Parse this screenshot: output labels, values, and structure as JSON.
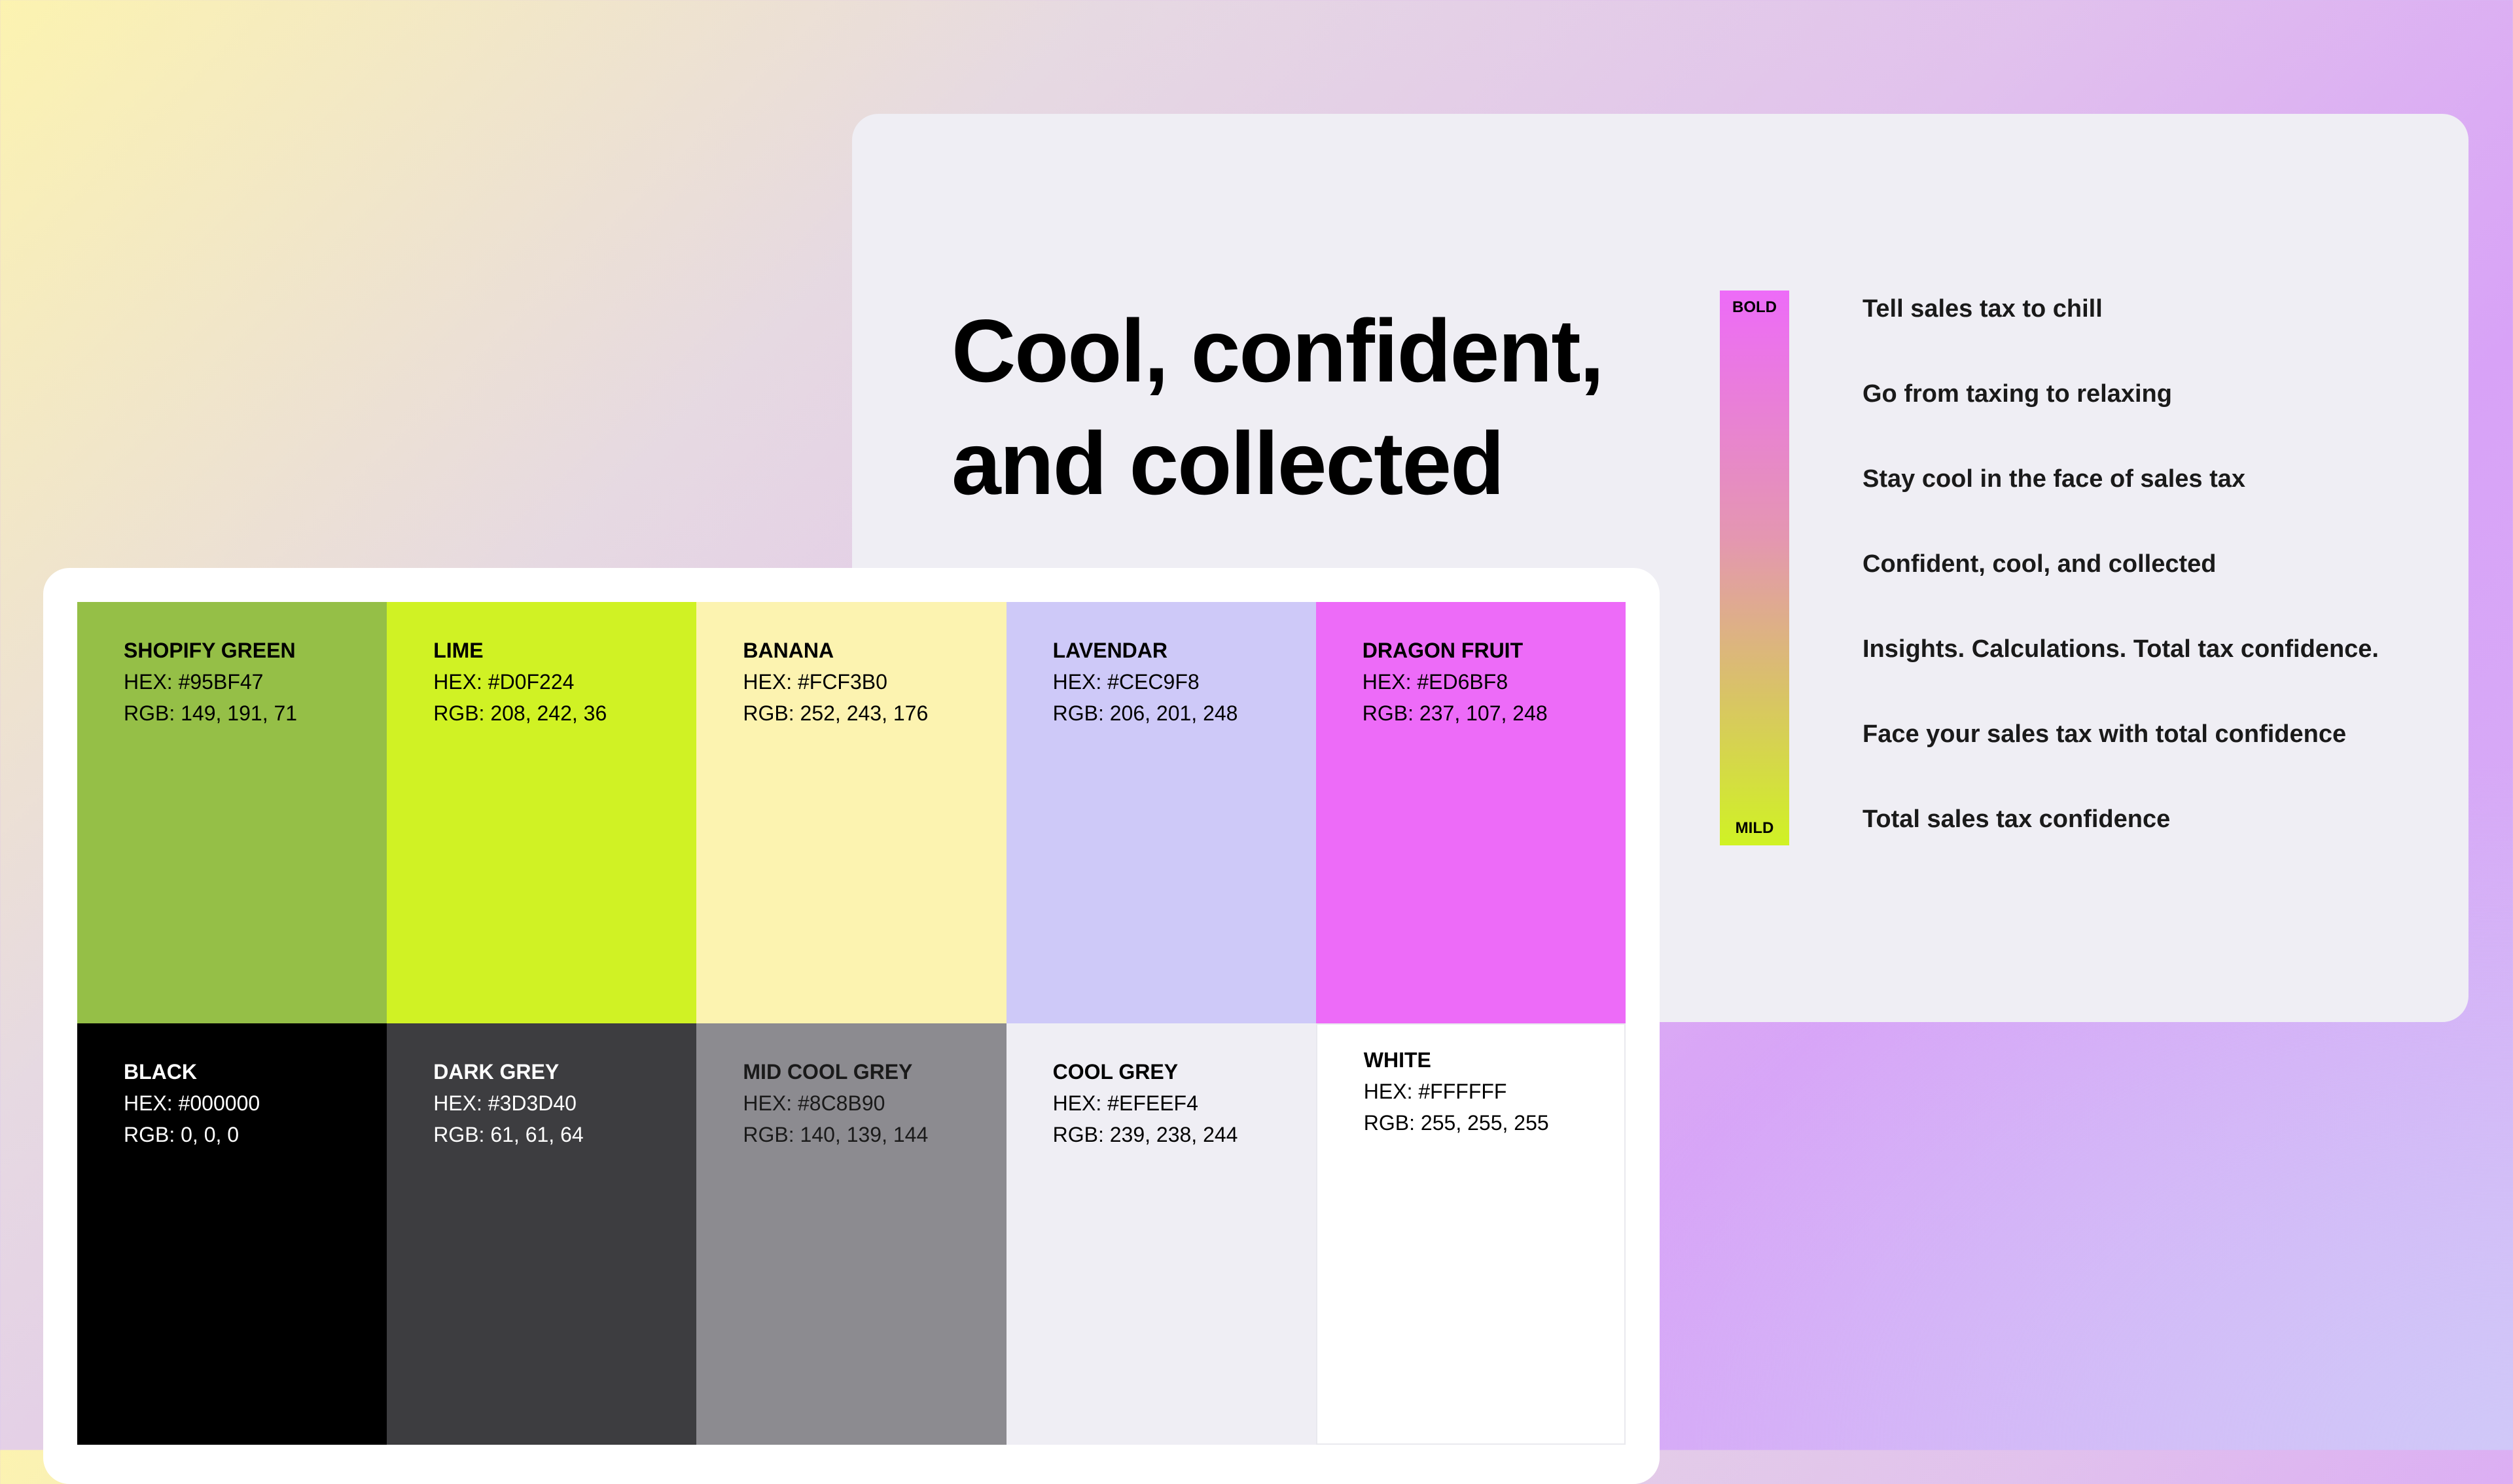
{
  "headline": {
    "line1": "Cool, confident,",
    "line2": "and collected"
  },
  "scale": {
    "top_label": "BOLD",
    "bottom_label": "MILD",
    "gradient_colors": [
      "#ED6BF8",
      "#D0F224"
    ]
  },
  "taglines": [
    "Tell sales tax to chill",
    "Go from taxing to relaxing",
    "Stay cool in the face of sales tax",
    "Confident, cool, and collected",
    "Insights. Calculations. Total tax confidence.",
    "Face your sales tax with total confidence",
    "Total sales tax confidence"
  ],
  "swatches": [
    {
      "name": "SHOPIFY GREEN",
      "hex": "HEX: #95BF47",
      "rgb": "RGB: 149, 191, 71",
      "color": "#95BF47",
      "text_color": "#000000"
    },
    {
      "name": "LIME",
      "hex": "HEX: #D0F224",
      "rgb": "RGB: 208, 242, 36",
      "color": "#D0F224",
      "text_color": "#000000"
    },
    {
      "name": "BANANA",
      "hex": "HEX: #FCF3B0",
      "rgb": "RGB: 252, 243, 176",
      "color": "#FCF3B0",
      "text_color": "#000000"
    },
    {
      "name": "LAVENDAR",
      "hex": "HEX: #CEC9F8",
      "rgb": "RGB: 206, 201, 248",
      "color": "#CEC9F8",
      "text_color": "#000000"
    },
    {
      "name": "DRAGON FRUIT",
      "hex": "HEX: #ED6BF8",
      "rgb": "RGB: 237, 107, 248",
      "color": "#ED6BF8",
      "text_color": "#000000"
    },
    {
      "name": "BLACK",
      "hex": "HEX: #000000",
      "rgb": "RGB: 0, 0, 0",
      "color": "#000000",
      "text_color": "#FFFFFF"
    },
    {
      "name": "DARK GREY",
      "hex": "HEX: #3D3D40",
      "rgb": "RGB: 61, 61, 64",
      "color": "#3D3D40",
      "text_color": "#FFFFFF"
    },
    {
      "name": "MID COOL GREY",
      "hex": "HEX: #8C8B90",
      "rgb": "RGB: 140, 139, 144",
      "color": "#8C8B90",
      "text_color": "#1A1A1A"
    },
    {
      "name": "COOL GREY",
      "hex": "HEX: #EFEEF4",
      "rgb": "RGB: 239, 238, 244",
      "color": "#EFEEF4",
      "text_color": "#000000"
    },
    {
      "name": "WHITE",
      "hex": "HEX: #FFFFFF",
      "rgb": "RGB: 255, 255, 255",
      "color": "#FFFFFF",
      "text_color": "#000000"
    }
  ]
}
